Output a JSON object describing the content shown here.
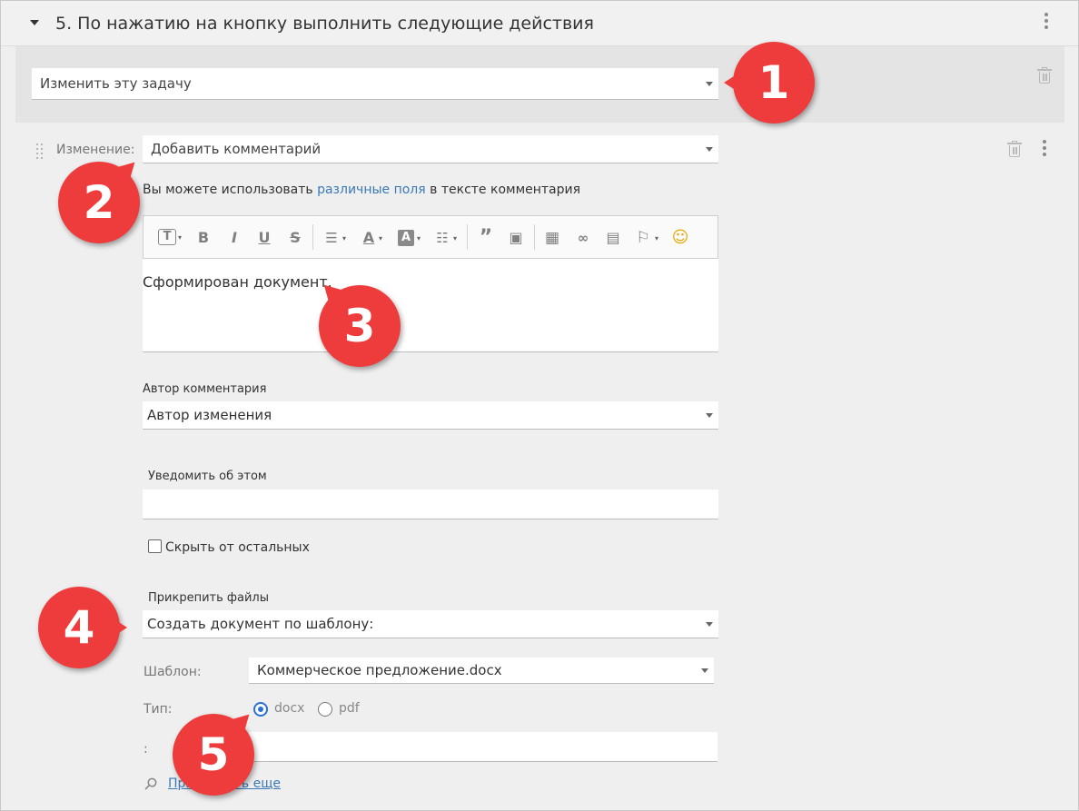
{
  "section": {
    "title": "5. По нажатию на кнопку выполнить следующие действия"
  },
  "action": {
    "value": "Изменить эту задачу"
  },
  "change": {
    "label": "Изменение:",
    "value": "Добавить комментарий",
    "hint_before": "Вы можете использовать",
    "hint_link": "различные поля",
    "hint_after": "в тексте комментария"
  },
  "toolbar": {
    "buttons": [
      "text-format",
      "bold",
      "italic",
      "underline",
      "strikethrough",
      "align",
      "font-color",
      "background-color",
      "list",
      "quote",
      "template",
      "table",
      "link",
      "image",
      "bookmark",
      "emoji"
    ]
  },
  "comment": {
    "text": "Сформирован документ."
  },
  "author": {
    "label": "Автор комментария",
    "value": "Автор изменения"
  },
  "notify": {
    "label": "Уведомить об этом",
    "value": ""
  },
  "hide": {
    "label": "Скрыть от остальных",
    "checked": false
  },
  "attach": {
    "label": "Прикрепить файлы",
    "value": "Создать документ по шаблону:",
    "template_label": "Шаблон:",
    "template_value": "Коммерческое предложение.docx",
    "type_label": "Тип:",
    "type_options": [
      "docx",
      "pdf"
    ],
    "type_selected": "docx",
    "name_label": ":",
    "name_value": "",
    "more_link": "Прикрепить еще"
  },
  "badges": [
    "1",
    "2",
    "3",
    "4",
    "5"
  ],
  "colors": {
    "badge": "#ee3b3b",
    "link": "#3a79b8",
    "radio": "#2a6fd6"
  }
}
